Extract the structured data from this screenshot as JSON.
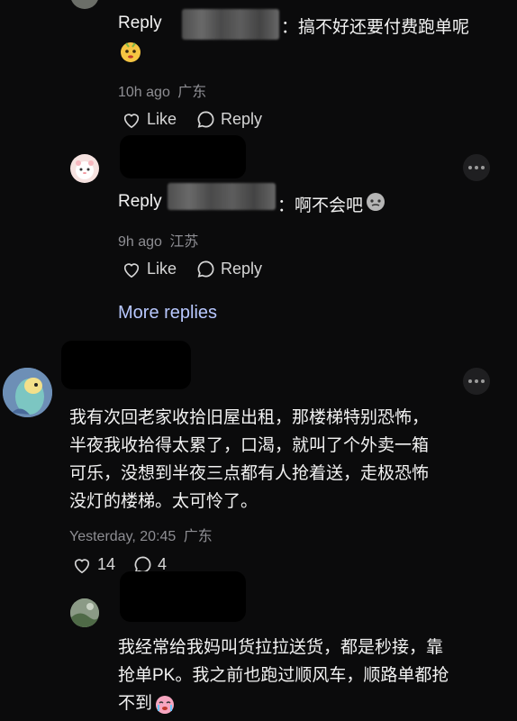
{
  "reply1": {
    "reply_label": "Reply",
    "text": "：搞不好还要付费跑单呢",
    "time": "10h ago",
    "location": "广东",
    "like_label": "Like",
    "reply_action": "Reply"
  },
  "reply2": {
    "reply_label": "Reply",
    "text": "：啊不会吧",
    "time": "9h ago",
    "location": "江苏",
    "like_label": "Like",
    "reply_action": "Reply"
  },
  "more_replies": "More replies",
  "comment1": {
    "lines": [
      "我有次回老家收拾旧屋出租，那楼梯特别恐怖，",
      "半夜我收拾得太累了，口渴，就叫了个外卖一箱",
      "可乐，没想到半夜三点都有人抢着送，走极恐怖",
      "没灯的楼梯。太可怜了。"
    ],
    "time": "Yesterday, 20:45",
    "location": "广东",
    "like_count": "14",
    "comment_count": "4"
  },
  "comment2": {
    "lines": [
      "我经常给我妈叫货拉拉送货，都是秒接，靠",
      "抢单PK。我之前也跑过顺风车，顺路单都抢",
      "不到"
    ]
  },
  "colors": {
    "background": "#0b0b0c",
    "link": "#b8c8ff",
    "muted": "#8e8e93"
  }
}
